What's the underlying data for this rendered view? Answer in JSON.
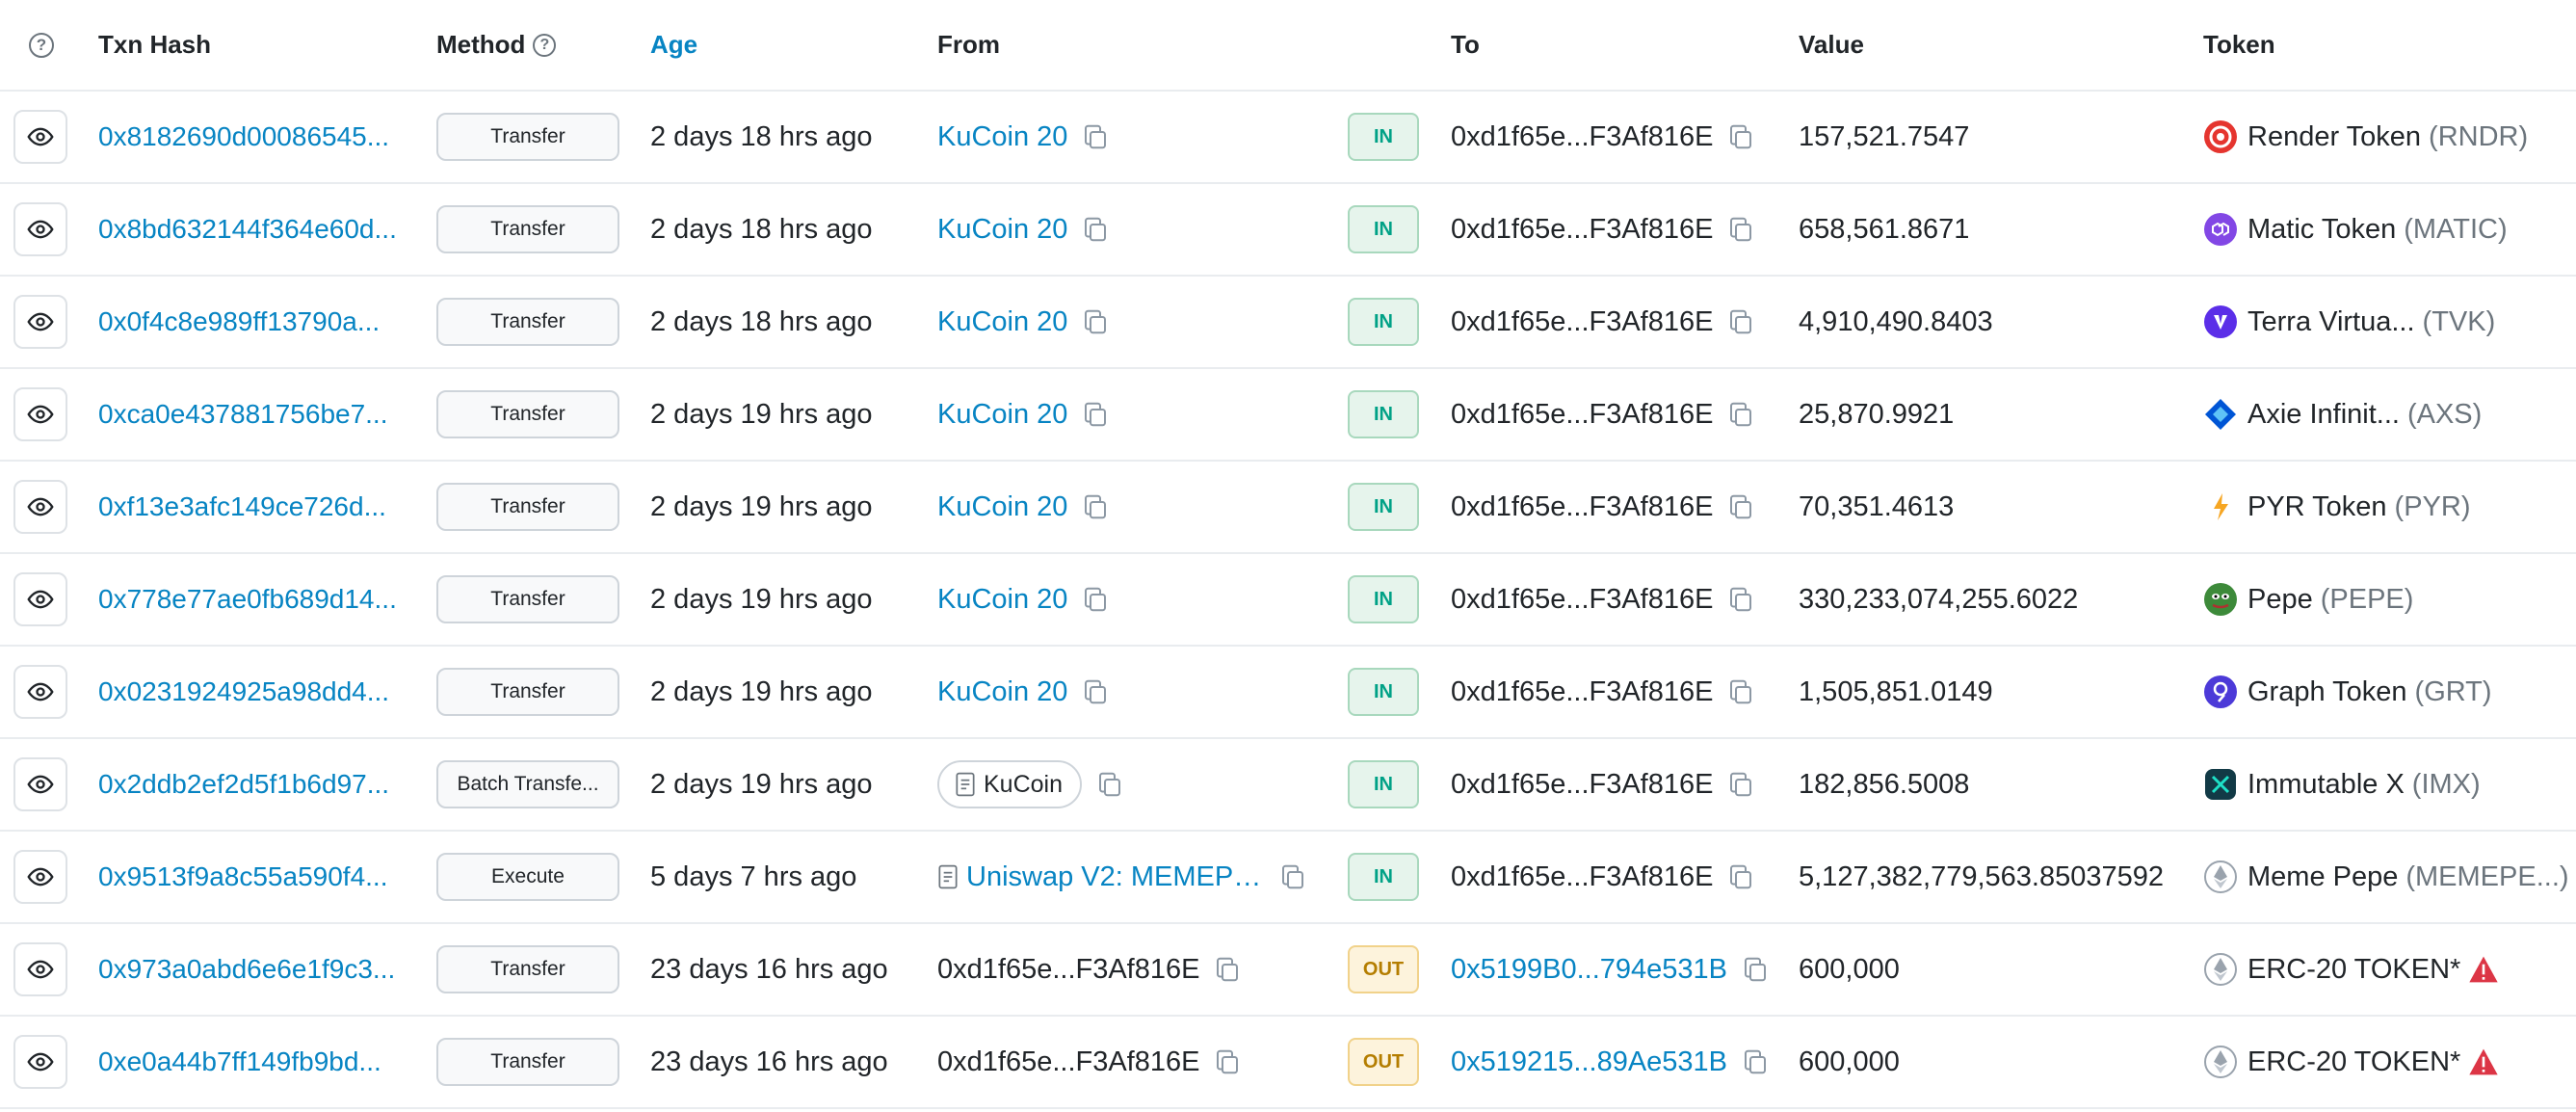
{
  "header": {
    "txn_hash": "Txn Hash",
    "method": "Method",
    "age": "Age",
    "from": "From",
    "to": "To",
    "value": "Value",
    "token": "Token"
  },
  "colors": {
    "link": "#0784c3",
    "in": "#00a186",
    "out": "#b47d00"
  },
  "rows": [
    {
      "hash": "0x8182690d00086545...",
      "method": "Transfer",
      "age": "2 days 18 hrs ago",
      "from": "KuCoin 20",
      "from_type": "link",
      "dir": "IN",
      "to": "0xd1f65e...F3Af816E",
      "to_type": "plain",
      "value": "157,521.7547",
      "token_name": "Render Token",
      "token_sym": "(RNDR)",
      "token_icon": "render-token-icon",
      "token_color": "#e5352f"
    },
    {
      "hash": "0x8bd632144f364e60d...",
      "method": "Transfer",
      "age": "2 days 18 hrs ago",
      "from": "KuCoin 20",
      "from_type": "link",
      "dir": "IN",
      "to": "0xd1f65e...F3Af816E",
      "to_type": "plain",
      "value": "658,561.8671",
      "token_name": "Matic Token",
      "token_sym": "(MATIC)",
      "token_icon": "matic-token-icon",
      "token_color": "#8247e5"
    },
    {
      "hash": "0x0f4c8e989ff13790a...",
      "method": "Transfer",
      "age": "2 days 18 hrs ago",
      "from": "KuCoin 20",
      "from_type": "link",
      "dir": "IN",
      "to": "0xd1f65e...F3Af816E",
      "to_type": "plain",
      "value": "4,910,490.8403",
      "token_name": "Terra Virtua...",
      "token_sym": "(TVK)",
      "token_icon": "tvk-token-icon",
      "token_color": "#5b2ee8"
    },
    {
      "hash": "0xca0e437881756be7...",
      "method": "Transfer",
      "age": "2 days 19 hrs ago",
      "from": "KuCoin 20",
      "from_type": "link",
      "dir": "IN",
      "to": "0xd1f65e...F3Af816E",
      "to_type": "plain",
      "value": "25,870.9921",
      "token_name": "Axie Infinit...",
      "token_sym": "(AXS)",
      "token_icon": "axs-token-icon",
      "token_color": "#0055d5"
    },
    {
      "hash": "0xf13e3afc149ce726d...",
      "method": "Transfer",
      "age": "2 days 19 hrs ago",
      "from": "KuCoin 20",
      "from_type": "link",
      "dir": "IN",
      "to": "0xd1f65e...F3Af816E",
      "to_type": "plain",
      "value": "70,351.4613",
      "token_name": "PYR Token",
      "token_sym": "(PYR)",
      "token_icon": "pyr-token-icon",
      "token_color": "#f6a623"
    },
    {
      "hash": "0x778e77ae0fb689d14...",
      "method": "Transfer",
      "age": "2 days 19 hrs ago",
      "from": "KuCoin 20",
      "from_type": "link",
      "dir": "IN",
      "to": "0xd1f65e...F3Af816E",
      "to_type": "plain",
      "value": "330,233,074,255.6022",
      "token_name": "Pepe",
      "token_sym": "(PEPE)",
      "token_icon": "pepe-token-icon",
      "token_color": "#3d8a3a"
    },
    {
      "hash": "0x0231924925a98dd4...",
      "method": "Transfer",
      "age": "2 days 19 hrs ago",
      "from": "KuCoin 20",
      "from_type": "link",
      "dir": "IN",
      "to": "0xd1f65e...F3Af816E",
      "to_type": "plain",
      "value": "1,505,851.0149",
      "token_name": "Graph Token",
      "token_sym": "(GRT)",
      "token_icon": "graph-token-icon",
      "token_color": "#4c3ad8"
    },
    {
      "hash": "0x2ddb2ef2d5f1b6d97...",
      "method": "Batch Transfe...",
      "age": "2 days 19 hrs ago",
      "from": "KuCoin",
      "from_type": "pill",
      "dir": "IN",
      "to": "0xd1f65e...F3Af816E",
      "to_type": "plain",
      "value": "182,856.5008",
      "token_name": "Immutable X",
      "token_sym": "(IMX)",
      "token_icon": "imx-token-icon",
      "token_color": "#123a46"
    },
    {
      "hash": "0x9513f9a8c55a590f4...",
      "method": "Execute",
      "age": "5 days 7 hrs ago",
      "from": "Uniswap V2: MEMEPE...",
      "from_type": "contract",
      "dir": "IN",
      "to": "0xd1f65e...F3Af816E",
      "to_type": "plain",
      "value": "5,127,382,779,563.85037592",
      "token_name": "Meme Pepe",
      "token_sym": "(MEMEPE...)",
      "token_icon": "eth-token-icon",
      "token_color": "#9aa3ad"
    },
    {
      "hash": "0x973a0abd6e6e1f9c3...",
      "method": "Transfer",
      "age": "23 days 16 hrs ago",
      "from": "0xd1f65e...F3Af816E",
      "from_type": "plain",
      "dir": "OUT",
      "to": "0x5199B0...794e531B",
      "to_type": "link",
      "value": "600,000",
      "token_name": "ERC-20 TOKEN*",
      "token_sym": "",
      "token_icon": "eth-token-icon",
      "token_color": "#9aa3ad",
      "warning": true
    },
    {
      "hash": "0xe0a44b7ff149fb9bd...",
      "method": "Transfer",
      "age": "23 days 16 hrs ago",
      "from": "0xd1f65e...F3Af816E",
      "from_type": "plain",
      "dir": "OUT",
      "to": "0x519215...89Ae531B",
      "to_type": "link",
      "value": "600,000",
      "token_name": "ERC-20 TOKEN*",
      "token_sym": "",
      "token_icon": "eth-token-icon",
      "token_color": "#9aa3ad",
      "warning": true
    }
  ]
}
